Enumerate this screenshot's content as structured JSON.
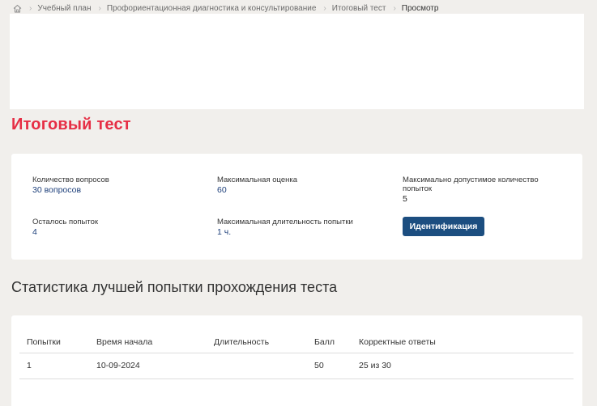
{
  "breadcrumb": {
    "items": [
      "Учебный план",
      "Профориентационная диагностика и консультирование",
      "Итоговый тест"
    ],
    "current": "Просмотр"
  },
  "page_title": "Итоговый тест",
  "info": {
    "questions_label": "Количество вопросов",
    "questions_value": "30 вопросов",
    "max_score_label": "Максимальная оценка",
    "max_score_value": "60",
    "max_attempts_label": "Максимально допустимое количество попыток",
    "max_attempts_value": "5",
    "remaining_label": "Осталось попыток",
    "remaining_value": "4",
    "max_duration_label": "Максимальная длительность попытки",
    "max_duration_value": "1 ч.",
    "ident_button": "Идентификация"
  },
  "stats": {
    "title": "Статистика лучшей попытки прохождения теста",
    "columns": [
      "Попытки",
      "Время начала",
      "Длительность",
      "Балл",
      "Корректные ответы"
    ],
    "rows": [
      {
        "attempt": "1",
        "start": "10-09-2024",
        "duration": "",
        "score": "50",
        "correct": "25 из 30"
      }
    ]
  },
  "colors": {
    "title_red": "#e62e45",
    "button_blue": "#1c4e80",
    "value_blue": "#1d3f7a",
    "background": "#f1efec"
  }
}
